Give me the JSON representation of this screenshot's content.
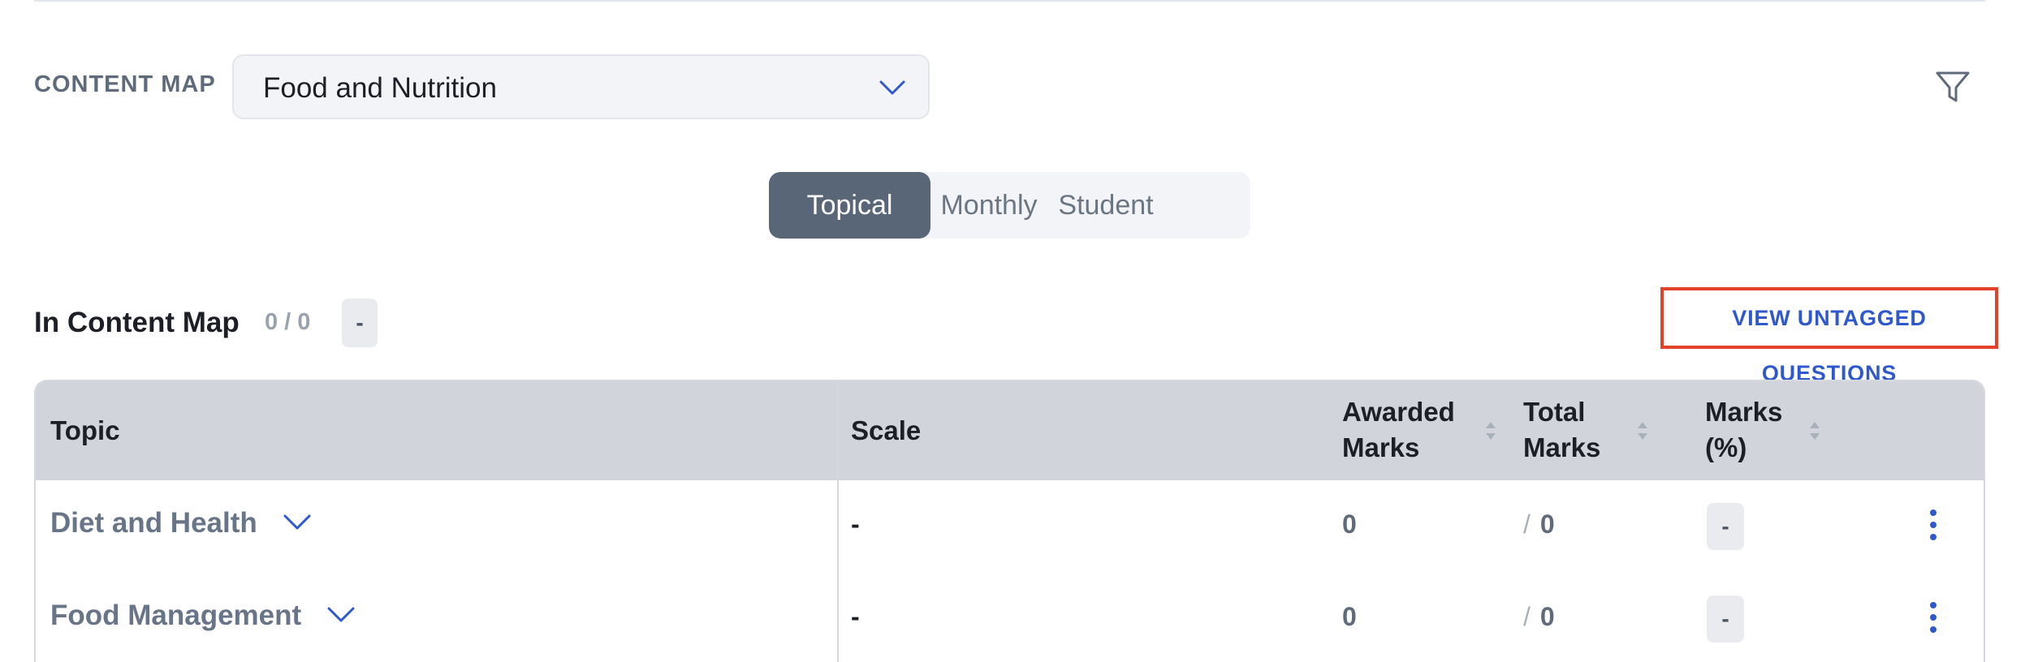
{
  "content_map": {
    "label": "CONTENT MAP",
    "selected": "Food and Nutrition"
  },
  "icons": {
    "chevron": "chevron-down-icon",
    "filter": "filter-icon",
    "sort": "sort-icon",
    "more": "more-vertical-icon"
  },
  "colors": {
    "accent": "#2f58cd",
    "segment_active": "#596677",
    "highlight_border": "#e2412c",
    "table_header": "#d1d5db"
  },
  "view_tabs": [
    {
      "label": "Topical",
      "active": true
    },
    {
      "label": "Monthly",
      "active": false
    },
    {
      "label": "Student",
      "active": false
    }
  ],
  "summary": {
    "title": "In Content Map",
    "count": "0 / 0",
    "badge": "-",
    "untagged_link": "VIEW UNTAGGED QUESTIONS"
  },
  "table": {
    "headers": {
      "topic": "Topic",
      "scale": "Scale",
      "awarded_1": "Awarded",
      "awarded_2": "Marks",
      "total_1": "Total",
      "total_2": "Marks",
      "pct_1": "Marks",
      "pct_2": "(%)"
    },
    "rows": [
      {
        "topic": "Diet and Health",
        "scale": "-",
        "awarded": "0",
        "slash": "/",
        "total": "0",
        "pct": "-"
      },
      {
        "topic": "Food Management",
        "scale": "-",
        "awarded": "0",
        "slash": "/",
        "total": "0",
        "pct": "-"
      }
    ]
  }
}
